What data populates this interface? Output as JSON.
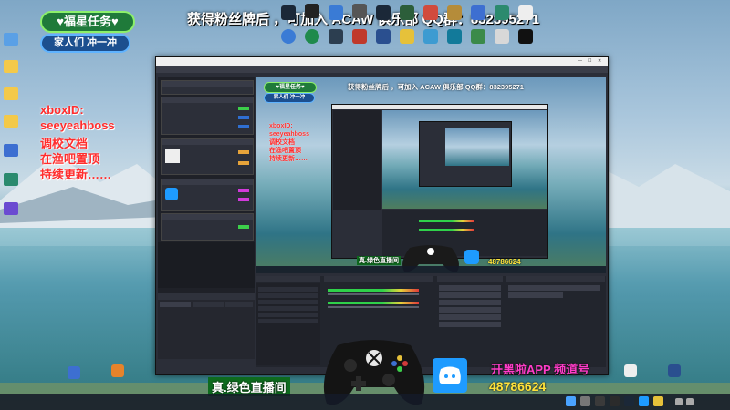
{
  "overlay": {
    "badge_green": "♥福星任务♥",
    "badge_blue": "家人们 冲一冲",
    "fans_line": "获得粉丝牌后 ，可加入 ACAW 俱乐部 QQ群：832395271",
    "red_lines": [
      "xboxID:",
      "seeyeahboss",
      "调校文档",
      "在渔吧置顶",
      "持续更新……"
    ],
    "stream_label": "真.绿色直播间",
    "app_promo": "开黑啦APP 频道号",
    "channel_number": "48786624"
  },
  "preview": {
    "badge_green": "♥福星任务♥",
    "badge_blue": "家人们 冲一冲",
    "fans_line": "获得粉丝牌后 ，可加入 ACAW 俱乐部 QQ群：832395271",
    "red_lines": [
      "xboxID:",
      "seeyeahboss",
      "调校文档",
      "在渔吧置顶",
      "持续更新……"
    ],
    "stream_label": "真.绿色直播间",
    "channel_number": "48786624"
  },
  "colors": {
    "accent_green": "#8cf06a",
    "accent_blue": "#5fb3ff",
    "text_red": "#ff2d2d",
    "text_pink": "#ff3cc8",
    "text_yellow": "#ffe23a",
    "obs_bg": "#2b2e38"
  }
}
